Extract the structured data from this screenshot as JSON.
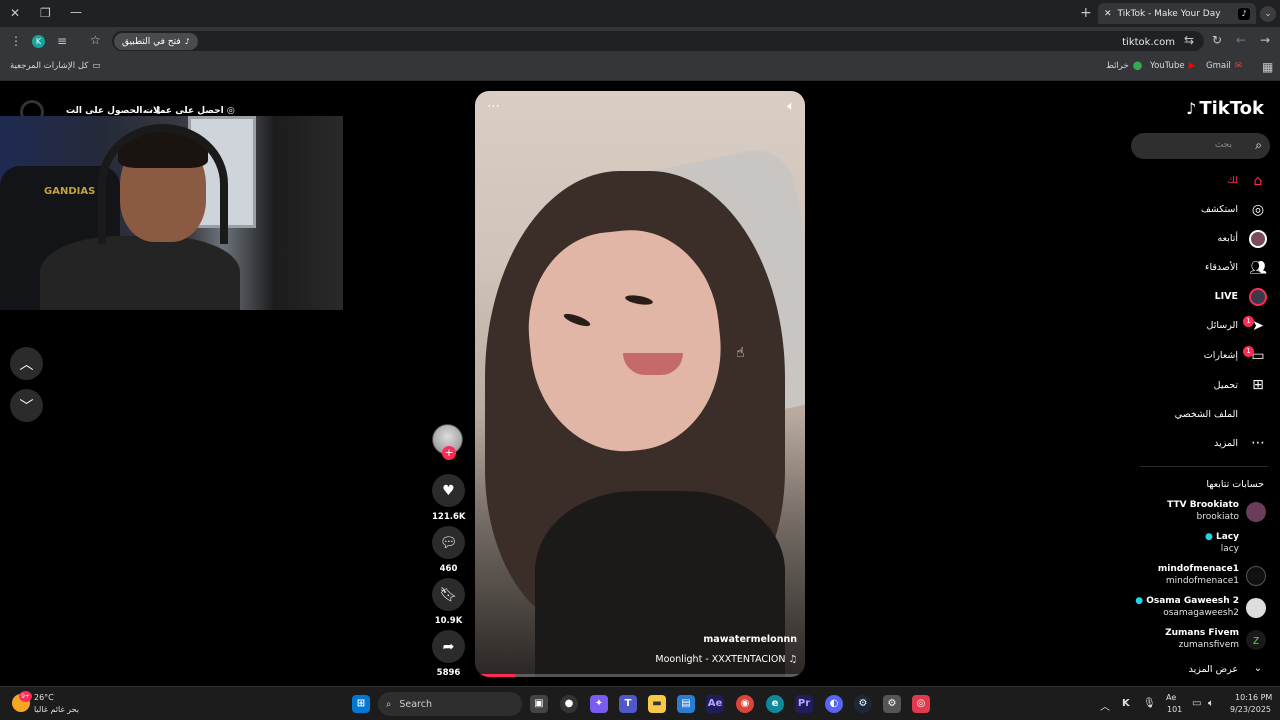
{
  "browser": {
    "tab_title": "TikTok - Make Your Day",
    "url": "tiktok.com",
    "open_in_app": "فتح في التطبيق",
    "profile_initial": "K",
    "bookmarks": {
      "all_bookmarks": "كل الإشارات المرجعية",
      "gmail": "Gmail",
      "youtube": "YouTube",
      "maps": "خرائط"
    }
  },
  "page_top_links": {
    "get_coins": "احصل على عملات",
    "get_app": "الحصول على الت..."
  },
  "webcam": {
    "chair_text": "GANDIAS"
  },
  "video": {
    "author": "mawatermelonnn",
    "music": "Moonlight - XXXTENTACION ♫",
    "progress": 0.12
  },
  "actions": {
    "likes": "121.6K",
    "comments": "460",
    "saves": "10.9K",
    "shares": "5896"
  },
  "sidebar": {
    "logo": "TikTok",
    "search_placeholder": "بحث",
    "nav": {
      "for_you": "لك",
      "explore": "استكشف",
      "following": "أتابعه",
      "friends": "الأصدقاء",
      "live": "LIVE",
      "messages": "الرسائل",
      "messages_badge": "1",
      "activity": "إشعارات",
      "activity_badge": "1",
      "upload": "تحميل",
      "profile": "الملف الشخصي",
      "more": "المزيد"
    },
    "following_title": "حسابات تتابعها",
    "following": [
      {
        "name": "TTV Brookiato",
        "handle": "brookiato"
      },
      {
        "name": "Lacy",
        "handle": "lacy"
      },
      {
        "name": "mindofmenace1",
        "handle": "mindofmenace1"
      },
      {
        "name": "Osama Gaweesh 2",
        "handle": "osamagaweesh2"
      },
      {
        "name": "Zumans Fivem",
        "handle": "zumansfivem"
      }
    ],
    "see_more": "عرض المزيد"
  },
  "taskbar": {
    "weather_temp": "26°C",
    "weather_desc": "بحر غائم غالبا",
    "weather_badge": "9+",
    "search": "Search",
    "time": "10:16 PM",
    "date": "9/23/2025",
    "lang": "Ae",
    "lang_num": "101"
  },
  "colors": {
    "accent": "#fe2c55",
    "background": "#000000",
    "chrome": "#35363a"
  }
}
